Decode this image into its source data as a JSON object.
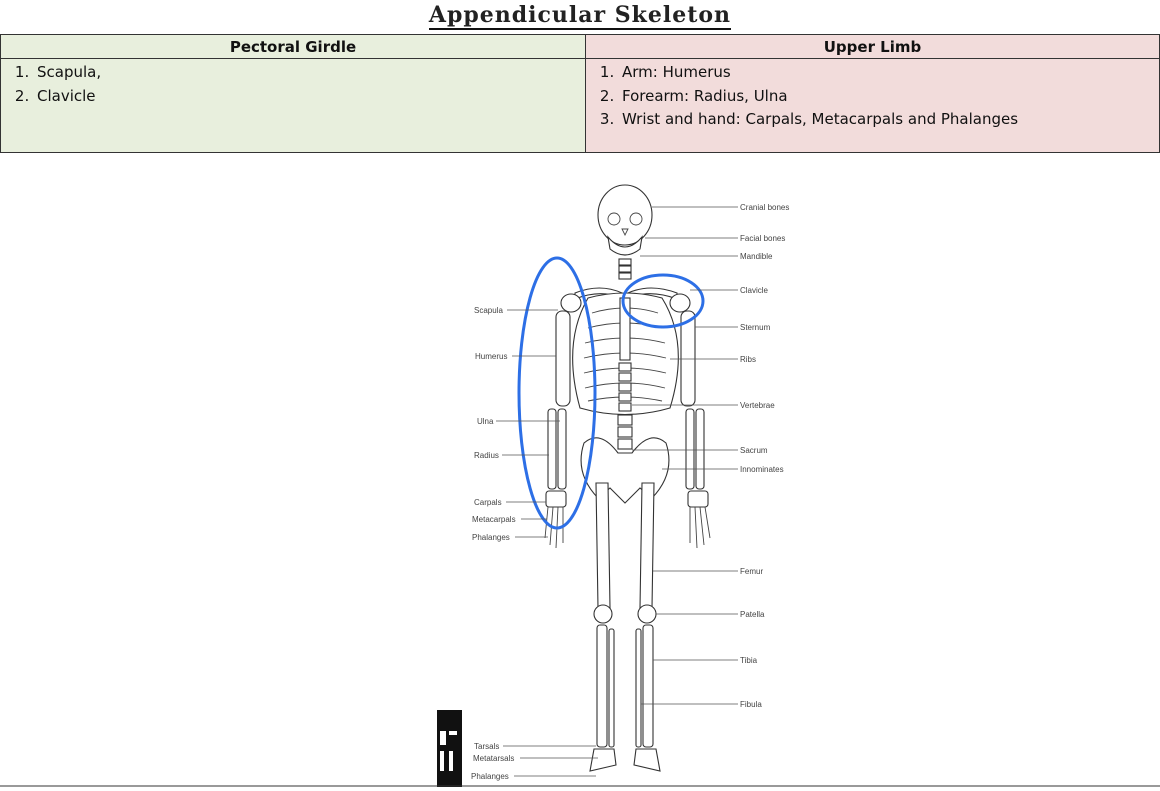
{
  "title": "Appendicular Skeleton",
  "table": {
    "col1_header": "Pectoral Girdle",
    "col2_header": "Upper Limb",
    "col1_items": [
      "Scapula,",
      "Clavicle"
    ],
    "col2_items": [
      "Arm: Humerus",
      "Forearm: Radius, Ulna",
      "Wrist and hand: Carpals, Metacarpals and Phalanges"
    ],
    "col1_bg": "#e8efdd",
    "col2_bg": "#f2dcdb"
  },
  "diagram": {
    "labels_right": [
      "Cranial bones",
      "Facial bones",
      "Mandible",
      "Clavicle",
      "Sternum",
      "Ribs",
      "Vertebrae",
      "Sacrum",
      "Innominates",
      "Femur",
      "Patella",
      "Tibia",
      "Fibula"
    ],
    "labels_left": [
      "Scapula",
      "Humerus",
      "Ulna",
      "Radius",
      "Carpals",
      "Metacarpals",
      "Phalanges",
      "Tarsals",
      "Metatarsals",
      "Phalanges"
    ],
    "highlight_color": "#2d6fe6"
  }
}
